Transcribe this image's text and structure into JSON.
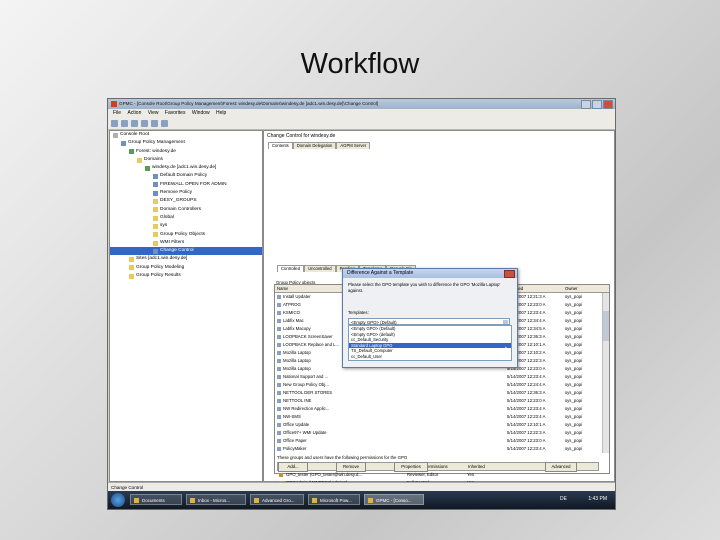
{
  "slide": {
    "title": "Workflow"
  },
  "window": {
    "title": "GPMC - [Console Root\\Group Policy Management\\Forest: windesy.de\\Domains\\windesy.de [adc1.win.desy.de]\\Change Control]",
    "menu": [
      "File",
      "Action",
      "View",
      "Favorites",
      "Window",
      "Help"
    ]
  },
  "tree": [
    {
      "label": "Console Root",
      "indent": 0,
      "icon": "root-icon"
    },
    {
      "label": "Group Policy Management",
      "indent": 1,
      "icon": "gpo-icon"
    },
    {
      "label": "Forest: windesy.de",
      "indent": 2,
      "icon": "domain-icon"
    },
    {
      "label": "Domains",
      "indent": 3,
      "icon": "folder-icon"
    },
    {
      "label": "windesy.de [adc1.win.desy.de]",
      "indent": 4,
      "icon": "domain-icon"
    },
    {
      "label": "Default Domain Policy",
      "indent": 5,
      "icon": "gpo-icon"
    },
    {
      "label": "FIREWALL OPEN FOR ADMIN",
      "indent": 5,
      "icon": "gpo-icon"
    },
    {
      "label": "Remove Policy",
      "indent": 5,
      "icon": "gpo-icon"
    },
    {
      "label": "DESY_GROUPS",
      "indent": 5,
      "icon": "folder-icon"
    },
    {
      "label": "Domain Controllers",
      "indent": 5,
      "icon": "folder-icon"
    },
    {
      "label": "Global",
      "indent": 5,
      "icon": "folder-icon"
    },
    {
      "label": "sys",
      "indent": 5,
      "icon": "folder-icon"
    },
    {
      "label": "Group Policy Objects",
      "indent": 5,
      "icon": "folder-icon"
    },
    {
      "label": "WMI Filters",
      "indent": 5,
      "icon": "folder-icon"
    },
    {
      "label": "Change Control",
      "indent": 5,
      "icon": "gpo-icon",
      "selected": true
    },
    {
      "label": "Sites [adc1.win.desy.de]",
      "indent": 2,
      "icon": "folder-icon"
    },
    {
      "label": "Group Policy Modeling",
      "indent": 2,
      "icon": "folder-icon"
    },
    {
      "label": "Group Policy Results",
      "indent": 2,
      "icon": "folder-icon"
    }
  ],
  "right_panel": {
    "header": "Change Control for windesy.de",
    "tabs": [
      "Contents",
      "Domain Delegation",
      "AGPM Server"
    ],
    "subtabs": [
      "Controlled",
      "Uncontrolled",
      "Pending",
      "Templates",
      "Recycle Bin"
    ],
    "group_label": "Group Policy objects",
    "columns": [
      "Name",
      "Com...",
      "User",
      "State",
      "GPO Status",
      "WMI Filter",
      "Modified",
      "Owner"
    ],
    "rows": [
      [
        "Install Updater",
        "53",
        "10",
        "Checked In",
        "Enabled",
        "None",
        "5/14/2007 12:21:3 A",
        "sys_popi"
      ],
      [
        "ATPROG",
        "13",
        "0",
        "Checked In",
        "User configura",
        "None",
        "5/14/2007 12:23:0 A",
        "sys_popi"
      ],
      [
        "KSMICO",
        "13",
        "0",
        "Checked In",
        "User configura",
        "SP2",
        "5/14/2007 12:23:4 A",
        "sys_popi"
      ],
      [
        "Labfix Mac",
        "14",
        "19",
        "Checked In",
        "Enabled",
        "None",
        "5/14/2007 12:34:4 A",
        "sys_popi"
      ],
      [
        "Labfix Macopy",
        "13",
        "15",
        "Checked In",
        "Enabled",
        "None",
        "5/14/2007 12:34:5 A",
        "sys_popi"
      ],
      [
        "LOOPBACK ScreenSaver",
        "3",
        "1",
        "Checked In",
        "Computer confi...",
        "None",
        "5/14/2007 12:36:3 A",
        "sys_popi"
      ],
      [
        "LOOPBACK Replace and L...",
        "14",
        "0",
        "Checked In",
        "Enabled",
        "None",
        "5/14/2007 12:10:1 A",
        "sys_popi"
      ],
      [
        "Mozilla Laptop",
        "34",
        "33",
        "Checked In",
        "Enabled",
        "None",
        "5/14/2007 12:10:2 A",
        "sys_popi"
      ],
      [
        "Mozilla Laptop",
        "39",
        "30",
        "Checked In",
        "Enabled",
        "None",
        "5/14/2007 12:22:3 A",
        "sys_popi"
      ],
      [
        "Mozilla Laptop",
        "",
        "",
        "",
        "",
        "",
        "5/14/2007 12:23:0 A",
        "sys_popi"
      ],
      [
        "National Support and ...",
        "",
        "",
        "",
        "",
        "",
        "5/14/2007 12:23:4 A",
        "sys_popi"
      ],
      [
        "New Group Policy Obj...",
        "",
        "",
        "",
        "",
        "",
        "5/14/2007 12:24:4 A",
        "sys_popi"
      ],
      [
        "NETTOOL DER STORES",
        "",
        "",
        "",
        "",
        "",
        "5/14/2007 12:36:3 A",
        "sys_popi"
      ],
      [
        "NETTOOL INE",
        "",
        "",
        "",
        "",
        "",
        "5/14/2007 12:23:0 A",
        "sys_popi"
      ],
      [
        "NW Redirection Applic...",
        "",
        "",
        "",
        "",
        "",
        "5/14/2007 12:23:4 A",
        "sys_popi"
      ],
      [
        "NW-SMS",
        "",
        "",
        "",
        "",
        "",
        "5/14/2007 12:23:4 A",
        "sys_popi"
      ],
      [
        "Office Update",
        "",
        "",
        "",
        "",
        "",
        "5/14/2007 12:10:1 A",
        "sys_popi"
      ],
      [
        "Office97+ WMI Update",
        "",
        "",
        "",
        "",
        "",
        "5/14/2007 12:22:3 A",
        "sys_popi"
      ],
      [
        "Office Paper",
        "",
        "",
        "",
        "",
        "",
        "5/14/2007 12:23:0 A",
        "sys_popi"
      ],
      [
        "PolicyMaker",
        "",
        "",
        "",
        "",
        "",
        "5/14/2007 12:23:4 A",
        "sys_popi"
      ]
    ],
    "perm_label": "These groups and users have the following permissions for the GPO",
    "perm_columns": [
      "Name",
      "Allowed Permissions",
      "Inherited"
    ],
    "perm_rows": [
      [
        "GPO_tester (GPO_tester@win.desy.d...",
        "Reviewer, Editor",
        "Yes"
      ],
      [
        "GPOAdmin (WINDESY\\Admins)",
        "Full Control",
        "Yes"
      ],
      [
        "Popinski, Rosemarie (popinski@win.de...",
        "Reviewer, Editor",
        "Yes"
      ],
      [
        "sys_popinski (sys_popinski@win.desy...",
        "Full Control",
        "No"
      ]
    ],
    "buttons": {
      "add": "Add...",
      "remove": "Remove",
      "properties": "Properties",
      "advanced": "Advanced"
    }
  },
  "dialog": {
    "title": "Difference Against a Template",
    "instruction": "Please select the GPO template you wish to difference the GPO 'Mozilla Laptop' against.",
    "template_label": "Templates:",
    "selected_value": "<Empty GPO> (Default)",
    "options": [
      "<Empty GPO> (Default)",
      "<Empty GPO> (default)",
      "cc_Default_Security",
      "Standard Laptop GPO",
      "TS_Default_Computer",
      "cc_Default_User"
    ],
    "highlighted_index": 3
  },
  "status": {
    "text": "Change Control"
  },
  "taskbar": {
    "items": [
      "Documents",
      "Inbox - Micros...",
      "Advanced Gro...",
      "Microsoft Pow...",
      "GPMC - [Conso..."
    ],
    "active_index": 4,
    "lang": "DE",
    "clock": "1:43 PM"
  }
}
